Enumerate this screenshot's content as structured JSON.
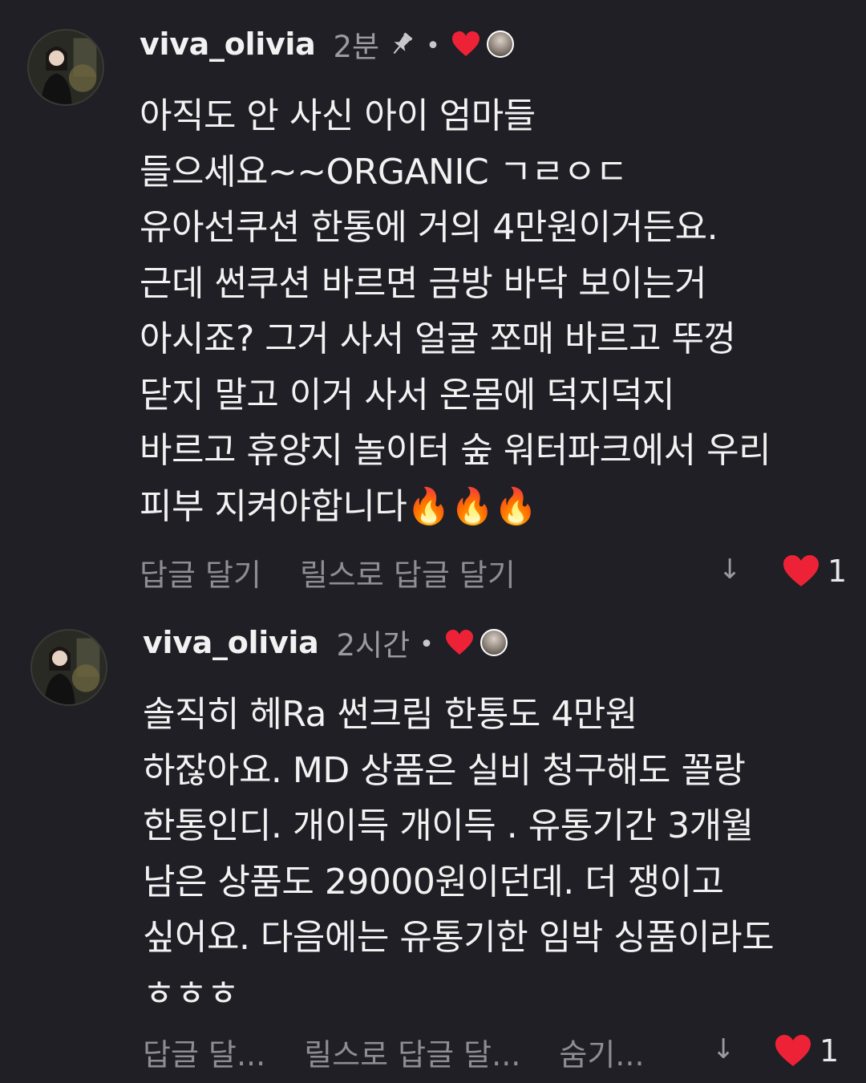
{
  "colors": {
    "background": "#1f1f25",
    "heart": "#ee2236",
    "muted": "#8d8d93",
    "text": "#f2f2f2"
  },
  "comments": [
    {
      "username": "viva_olivia",
      "time": "2분",
      "pinned": true,
      "dot": "•",
      "text": "아직도 안 사신 아이 엄마들\n들으세요~~ORGANIC ㄱㄹㅇㄷ\n유아선쿠션 한통에 거의 4만원이거든요.\n근데 썬쿠션 바르면 금방 바닥 보이는거\n아시죠? 그거 사서 얼굴 쪼매 바르고 뚜껑\n닫지 말고 이거 사서 온몸에 덕지덕지\n바르고 휴양지 놀이터 숲 워터파크에서 우리\n피부 지켜야합니다🔥🔥🔥",
      "actions": [
        "답글 달기",
        "릴스로 답글 달기"
      ],
      "download_icon": "↓",
      "likes": "1"
    },
    {
      "username": "viva_olivia",
      "time": "2시간",
      "pinned": false,
      "dot": "•",
      "text": "솔직히 헤Ra 썬크림 한통도 4만원\n하잖아요. MD 상품은 실비 청구해도 꼴랑\n한통인디. 개이득 개이득 . 유통기간 3개월\n남은 상품도 29000원이던데. 더 쟁이고\n싶어요. 다음에는 유통기한 임박 싱품이라도\nㅎㅎㅎ",
      "actions": [
        "답글 달...",
        "릴스로 답글 달...",
        "숨기..."
      ],
      "download_icon": "↓",
      "likes": "1"
    }
  ]
}
